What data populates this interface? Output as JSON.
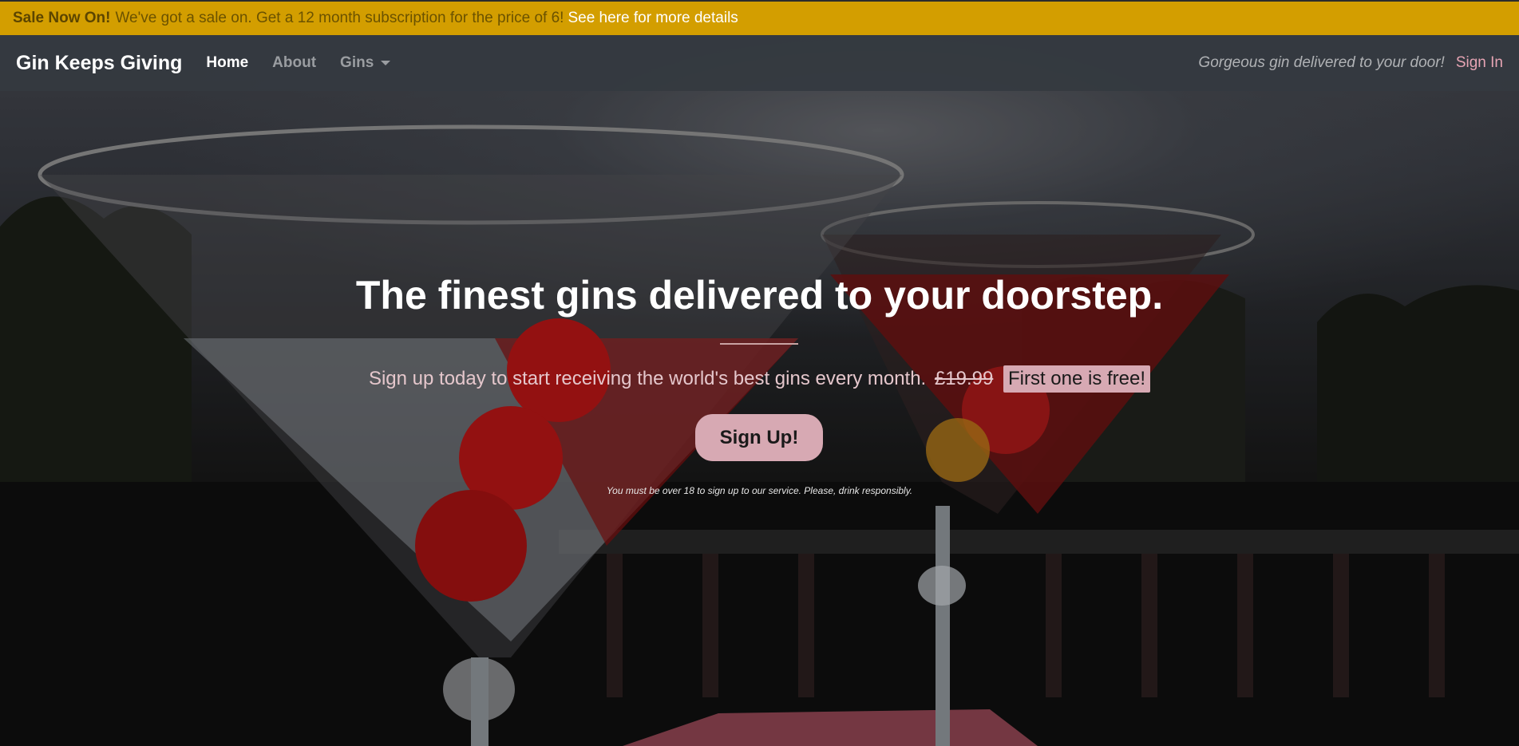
{
  "sale_banner": {
    "strong": "Sale Now On!",
    "text": "We've got a sale on. Get a 12 month subscription for the price of 6!",
    "link": "See here for more details"
  },
  "navbar": {
    "brand": "Gin Keeps Giving",
    "items": [
      {
        "label": "Home",
        "active": true
      },
      {
        "label": "About",
        "active": false
      },
      {
        "label": "Gins",
        "active": false,
        "dropdown": true
      }
    ],
    "tagline": "Gorgeous gin delivered to your door!",
    "signin": "Sign In"
  },
  "hero": {
    "title": "The finest gins delivered to your doorstep.",
    "subtitle": "Sign up today to start receiving the world's best gins every month.",
    "old_price": "£19.99",
    "free_badge": "First one is free!",
    "signup_button": "Sign Up!",
    "age_note": "You must be over 18 to sign up to our service. Please, drink responsibly."
  },
  "colors": {
    "banner": "#d39e00",
    "navbar": "#343a40",
    "accent_pink": "#d7a9b3",
    "signin_pink": "#e6a4b4"
  },
  "icons": {
    "dropdown": "caret-down-icon"
  }
}
